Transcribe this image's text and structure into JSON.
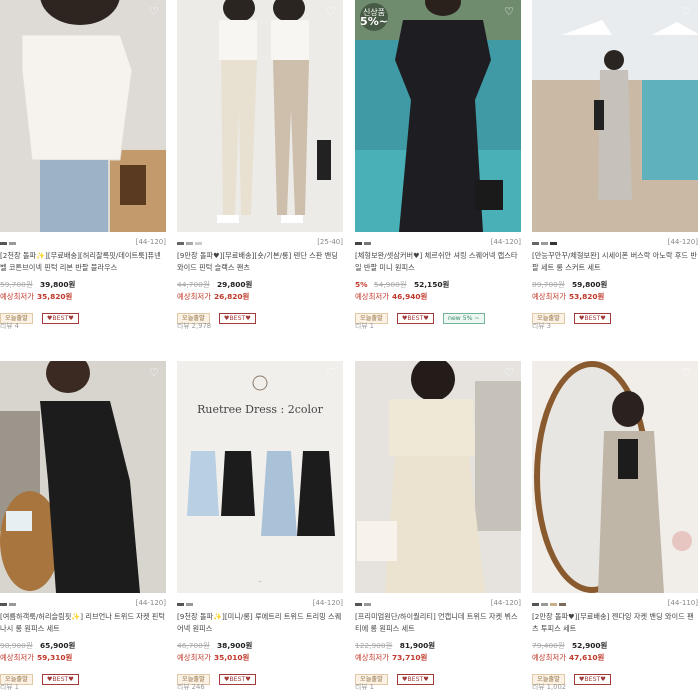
{
  "products": [
    {
      "colors": [
        "#555555",
        "#999999"
      ],
      "size": "[44-120]",
      "name": "[2천장 돌파✨][무료배송][허리잘록핏/데이트룩]퓨넨벨 코튼브이넥 핀턱 리본 반팔 블라우스",
      "original_price": "59,700원",
      "discount": "",
      "price": "39,800원",
      "est_label": "예상최저가",
      "est_price": "35,820원",
      "tags": [
        "오늘출발",
        "♥BEST♥"
      ],
      "review": "리뷰 4"
    },
    {
      "colors": [
        "#666666",
        "#aaaaaa",
        "#cccccc"
      ],
      "size": "[25-40]",
      "name": "[9만장 돌파♥][무료배송][숏/기본/롱] 텐단 스판 밴딩 와이드 핀턱 슬랙스 팬츠",
      "original_price": "44,700원",
      "discount": "",
      "price": "29,800원",
      "est_label": "예상최저가",
      "est_price": "26,820원",
      "tags": [
        "오늘출발",
        "♥BEST♥"
      ],
      "review": "리뷰 2,978"
    },
    {
      "colors": [
        "#444444",
        "#777777"
      ],
      "size": "[44-120]",
      "name": "[체형보완/셋삼커버♥] 체르쉬안 셔링 스퀘어넥 랩스타일 반팔 미니 원피스",
      "original_price": "54,900원",
      "discount": "5%",
      "price": "52,150원",
      "est_label": "예상최저가",
      "est_price": "46,940원",
      "tags": [
        "오늘출발",
        "♥BEST♥",
        "new 5% ~"
      ],
      "review": "리뷰 1",
      "sale_badge_top": "신상품",
      "sale_badge_pct": "5%~"
    },
    {
      "colors": [
        "#666666",
        "#999999",
        "#333333"
      ],
      "size": "[44-120]",
      "name": "[만능꾸안꾸/체형보완] 시세이폰 버스락 아노락 후드 반팔 세트 롱 스커트 세트",
      "original_price": "89,700원",
      "discount": "",
      "price": "59,800원",
      "est_label": "예상최저가",
      "est_price": "53,820원",
      "tags": [
        "오늘출발",
        "♥BEST♥"
      ],
      "review": "리뷰 3"
    },
    {
      "colors": [
        "#555555",
        "#999999"
      ],
      "size": "[44-120]",
      "name": "[여름하객룩/허리슬림핏✨] 리브언나 트위드 자켓 핀턱 나시 롱 원피스 세트",
      "original_price": "98,900원",
      "discount": "",
      "price": "65,900원",
      "est_label": "예상최저가",
      "est_price": "59,310원",
      "tags": [
        "오늘출발",
        "♥BEST♥"
      ],
      "review": "리뷰 1"
    },
    {
      "colors": [
        "#555555",
        "#999999"
      ],
      "size": "[44-120]",
      "name": "[9천장 돌파✨][미니/롱] 루에트리 트위드 트리밍 스퀘어넥 원피스",
      "original_price": "46,700원",
      "discount": "",
      "price": "38,900원",
      "est_label": "예상최저가",
      "est_price": "35,010원",
      "tags": [
        "오늘출발",
        "♥BEST♥"
      ],
      "review": "리뷰 246",
      "banner_title": "Ruetree Dress : 2color"
    },
    {
      "colors": [
        "#555555",
        "#999999"
      ],
      "size": "[44-120]",
      "name": "[프리미엄원단/하이퀄리티] 언캡니데 트위드 자켓 뷔스티에 롱 원피스 세트",
      "original_price": "122,900원",
      "discount": "",
      "price": "81,900원",
      "est_label": "예상최저가",
      "est_price": "73,710원",
      "tags": [
        "오늘출발",
        "♥BEST♥"
      ],
      "review": "리뷰 1"
    },
    {
      "colors": [
        "#555555",
        "#999999",
        "#c8b08a",
        "#7a6a5a"
      ],
      "size": "[44-110]",
      "name": "[2만장 돌파♥][무료배송] 젠다잉 자켓 밴딩 와이드 팬츠 투피스 세트",
      "original_price": "79,400원",
      "discount": "",
      "price": "52,900원",
      "est_label": "예상최저가",
      "est_price": "47,610원",
      "tags": [
        "오늘출발",
        "♥BEST♥"
      ],
      "review": "리뷰 1,002"
    }
  ]
}
